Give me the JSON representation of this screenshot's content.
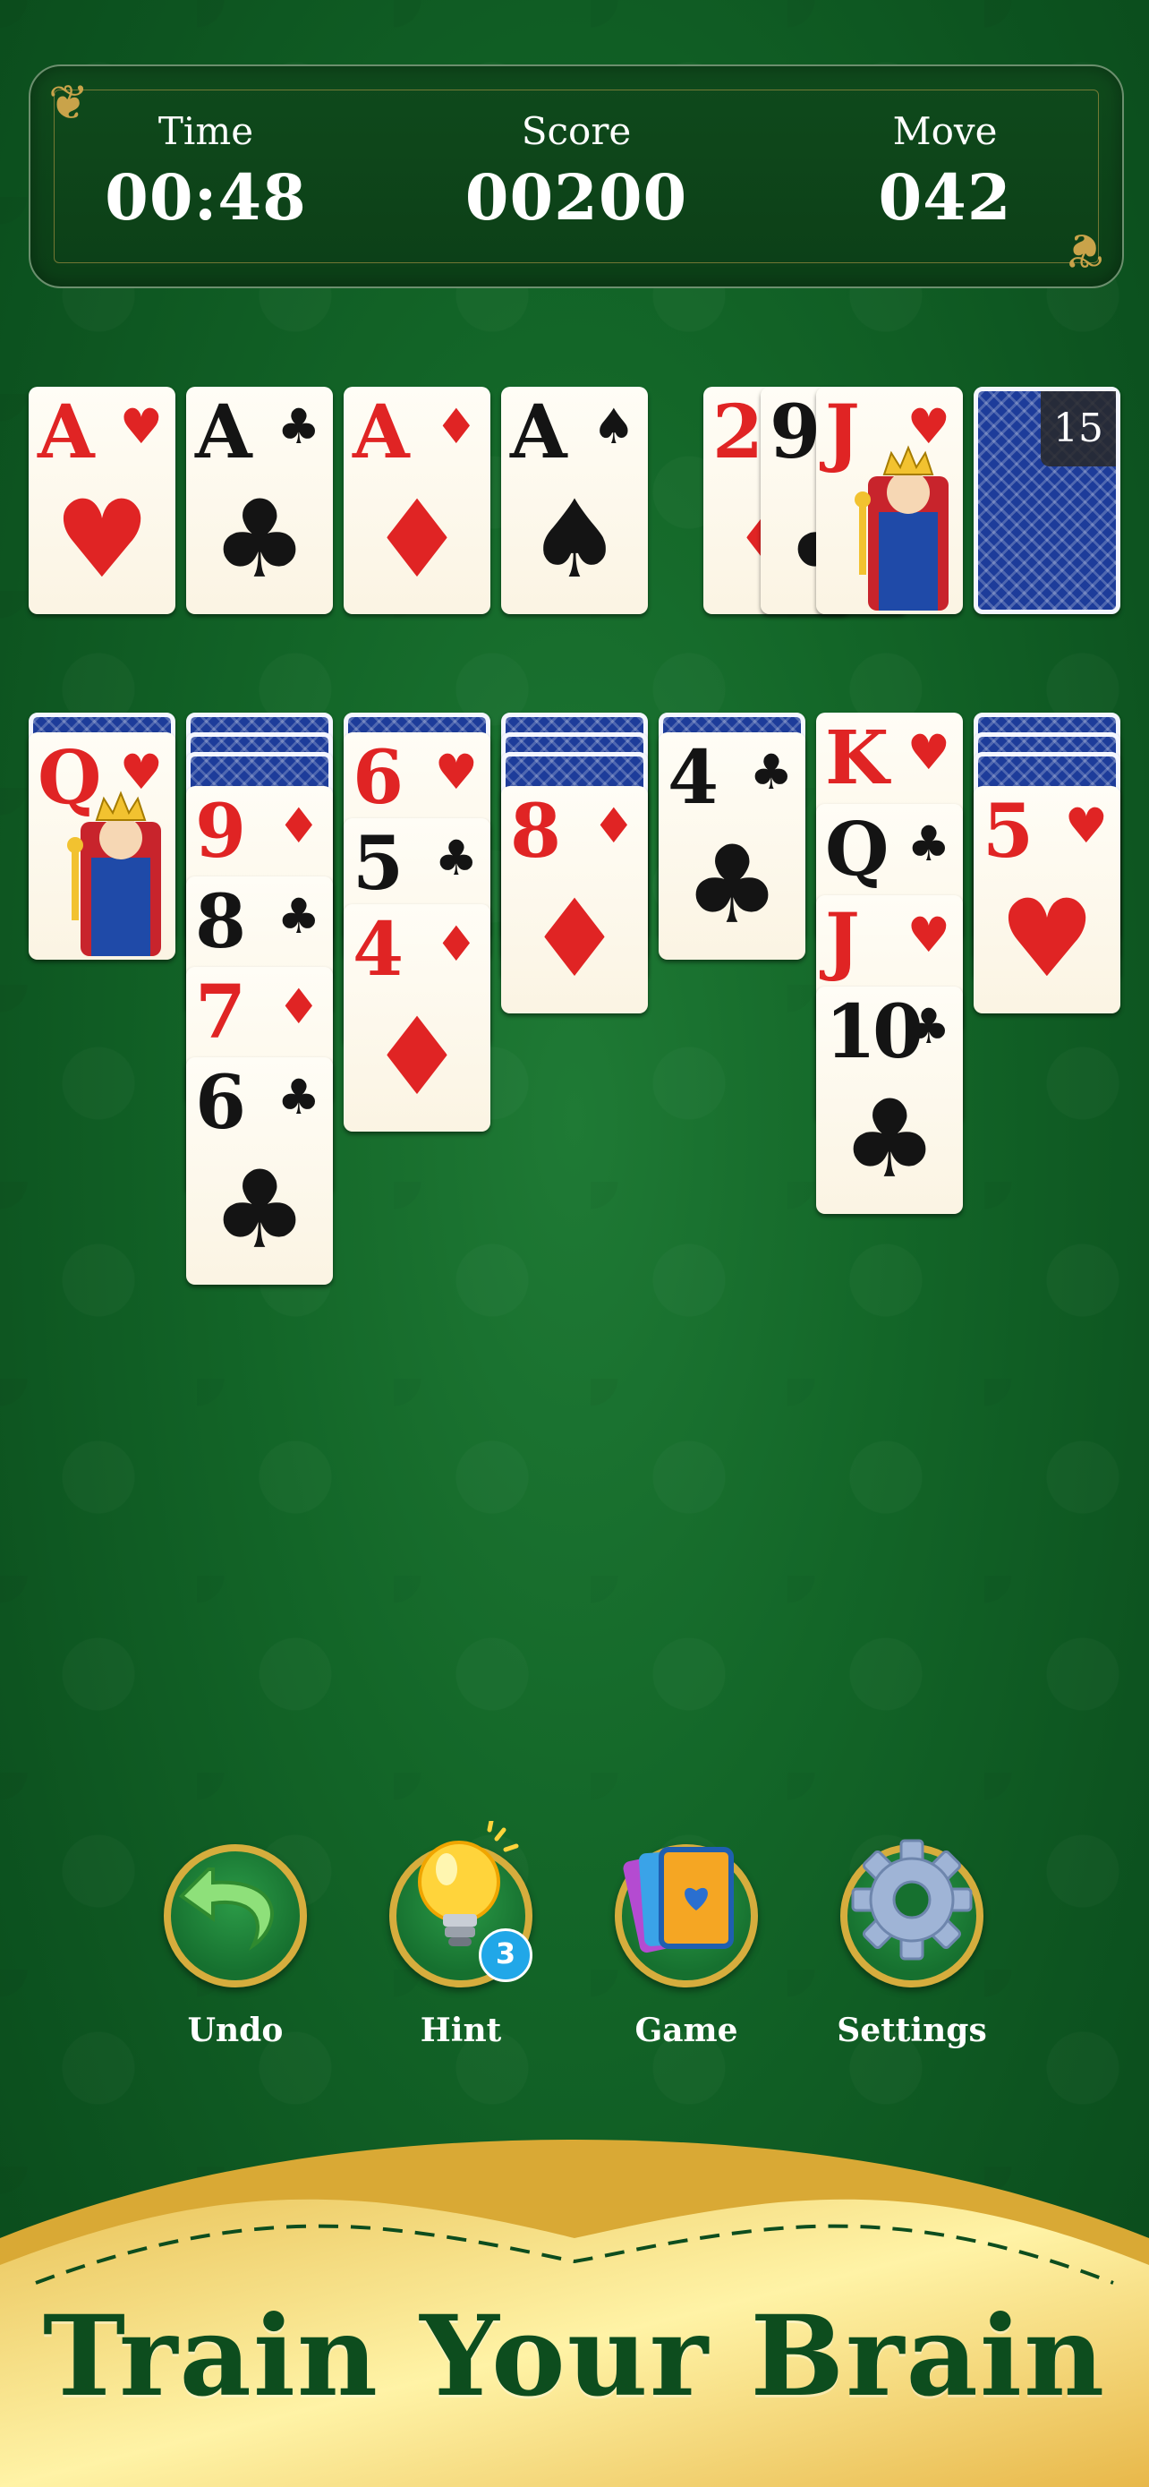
{
  "hud": {
    "time_label": "Time",
    "time_value": "00:48",
    "score_label": "Score",
    "score_value": "00200",
    "move_label": "Move",
    "move_value": "042"
  },
  "foundations": [
    {
      "rank": "A",
      "suit": "♥",
      "color": "red"
    },
    {
      "rank": "A",
      "suit": "♣",
      "color": "black"
    },
    {
      "rank": "A",
      "suit": "♦",
      "color": "red"
    },
    {
      "rank": "A",
      "suit": "♠",
      "color": "black"
    }
  ],
  "waste": [
    {
      "rank": "2",
      "suit": "♦",
      "color": "red"
    },
    {
      "rank": "9",
      "suit": "♣",
      "color": "black"
    },
    {
      "rank": "J",
      "suit": "♥",
      "color": "red"
    }
  ],
  "stock": {
    "count": "15"
  },
  "tableau": [
    {
      "face_down": 1,
      "cards": [
        {
          "rank": "Q",
          "suit": "♥",
          "color": "red"
        }
      ]
    },
    {
      "face_down": 3,
      "cards": [
        {
          "rank": "9",
          "suit": "♦",
          "color": "red"
        },
        {
          "rank": "8",
          "suit": "♣",
          "color": "black"
        },
        {
          "rank": "7",
          "suit": "♦",
          "color": "red"
        },
        {
          "rank": "6",
          "suit": "♣",
          "color": "black"
        }
      ]
    },
    {
      "face_down": 1,
      "cards": [
        {
          "rank": "6",
          "suit": "♥",
          "color": "red"
        },
        {
          "rank": "5",
          "suit": "♣",
          "color": "black"
        },
        {
          "rank": "4",
          "suit": "♦",
          "color": "red"
        }
      ]
    },
    {
      "face_down": 3,
      "cards": [
        {
          "rank": "8",
          "suit": "♦",
          "color": "red"
        }
      ]
    },
    {
      "face_down": 1,
      "cards": [
        {
          "rank": "4",
          "suit": "♣",
          "color": "black"
        }
      ]
    },
    {
      "face_down": 0,
      "cards": [
        {
          "rank": "K",
          "suit": "♥",
          "color": "red"
        },
        {
          "rank": "Q",
          "suit": "♣",
          "color": "black"
        },
        {
          "rank": "J",
          "suit": "♥",
          "color": "red"
        },
        {
          "rank": "10",
          "suit": "♣",
          "color": "black"
        }
      ]
    },
    {
      "face_down": 3,
      "cards": [
        {
          "rank": "5",
          "suit": "♥",
          "color": "red"
        }
      ]
    }
  ],
  "buttons": {
    "undo": "Undo",
    "hint": "Hint",
    "hint_badge": "3",
    "game": "Game",
    "settings": "Settings"
  },
  "banner": {
    "text": "Train Your Brain"
  },
  "colors": {
    "red": "#e02424",
    "black": "#141414",
    "felt": "#136628",
    "gold": "#d6ad3d"
  }
}
